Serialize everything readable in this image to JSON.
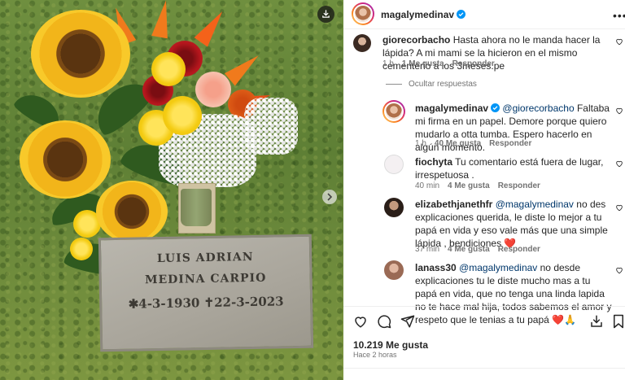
{
  "post": {
    "username": "magalymedinav",
    "plaque": {
      "line1": "LUIS ADRIAN",
      "line2": "MEDINA CARPIO",
      "line3": "✱4-3-1930 ✝22-3-2023"
    }
  },
  "comments": [
    {
      "username": "giorecorbacho",
      "text": "Hasta ahora no le manda hacer la lápida? A mi mami se la hicieron en el mismo cementerio a los 3meses.pe",
      "time": "1 h",
      "likes": "1 Me gusta",
      "reply": "Responder"
    }
  ],
  "hide_replies_label": "Ocultar respuestas",
  "replies": [
    {
      "username": "magalymedinav",
      "mention": "@giorecorbacho",
      "text": " Faltaba mi firma en un papel. Demore porque quiero mudarlo a otta tumba. Espero hacerlo en algún momento.",
      "time": "1 h",
      "likes": "40 Me gusta",
      "reply": "Responder"
    },
    {
      "username": "fiochyta",
      "text": "Tu comentario está fuera de lugar, irrespetuosa .",
      "time": "40 min",
      "likes": "4 Me gusta",
      "reply": "Responder"
    },
    {
      "username": "elizabethjanethfr",
      "mention": "@magalymedinav",
      "text": " no des explicaciones querida, le diste lo mejor a tu papá en vida y eso vale más que una simple lápida , bendiciones ❤️",
      "time": "37 min",
      "likes": "4 Me gusta",
      "reply": "Responder"
    },
    {
      "username": "lanass30",
      "mention": "@magalymedinav",
      "text": " no desde explicaciones tu le diste mucho mas a tu papá en vida, que no tenga una linda lapida no te hace mal hija, todos sabemos el amor y respeto que le tenias a tu papá ❤️🙏"
    }
  ],
  "footer": {
    "likes": "10.219 Me gusta",
    "time_ago": "Hace 2 horas"
  },
  "colors": {
    "verified": "#0095f6",
    "mention": "#00376b",
    "meta": "#737373"
  },
  "icons": [
    "download-icon",
    "next-arrow-icon",
    "more-options-icon",
    "heart-icon",
    "comment-icon",
    "share-icon",
    "save-icon",
    "verified-badge-icon"
  ]
}
